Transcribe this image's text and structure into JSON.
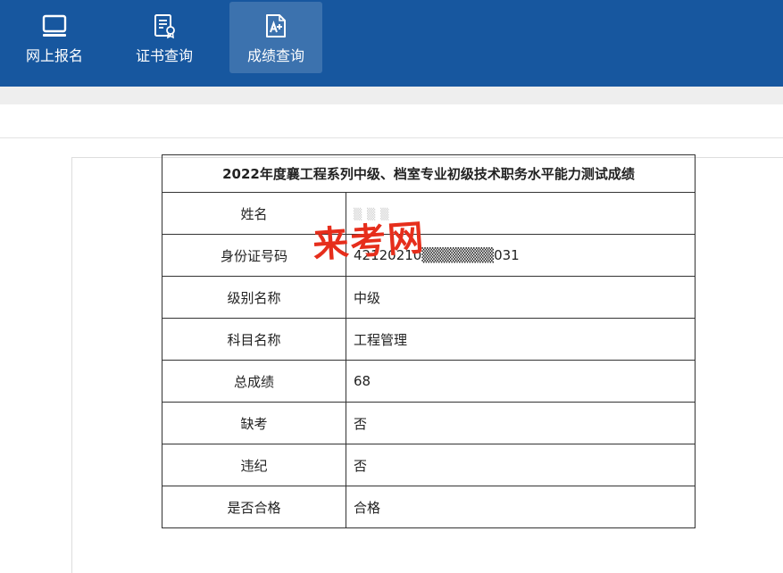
{
  "nav": {
    "items": [
      {
        "label": "网上报名",
        "icon": "monitor-icon"
      },
      {
        "label": "证书查询",
        "icon": "certificate-icon"
      },
      {
        "label": "成绩查询",
        "icon": "grade-document-icon",
        "active": true
      }
    ],
    "bar_color": "#17579f"
  },
  "result_table": {
    "title": "2022年度襄工程系列中级、档室专业初级技术职务水平能力测试成绩",
    "rows": [
      {
        "label": "姓名",
        "value": "▒ ▒ ▒"
      },
      {
        "label": "身份证号码",
        "value": "42120210▒▒▒▒▒▒▒031"
      },
      {
        "label": "级别名称",
        "value": "中级"
      },
      {
        "label": "科目名称",
        "value": "工程管理"
      },
      {
        "label": "总成绩",
        "value": "68"
      },
      {
        "label": "缺考",
        "value": "否"
      },
      {
        "label": "违纪",
        "value": "否"
      },
      {
        "label": "是否合格",
        "value": "合格"
      }
    ]
  },
  "watermark": {
    "text": "来考网",
    "color": "#e62e1c"
  }
}
